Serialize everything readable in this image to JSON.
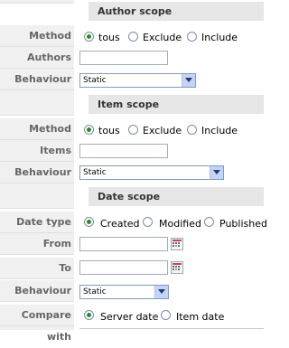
{
  "author_scope": {
    "title": "Author scope",
    "method_label": "Method",
    "method_options": [
      "tous",
      "Exclude",
      "Include"
    ],
    "authors_label": "Authors",
    "authors_value": "",
    "behaviour_label": "Behaviour",
    "behaviour_value": "Static"
  },
  "item_scope": {
    "title": "Item scope",
    "method_label": "Method",
    "method_options": [
      "tous",
      "Exclude",
      "Include"
    ],
    "items_label": "Items",
    "items_value": "",
    "behaviour_label": "Behaviour",
    "behaviour_value": "Static"
  },
  "date_scope": {
    "title": "Date scope",
    "date_type_label": "Date type",
    "date_type_options": [
      "Created",
      "Modified",
      "Published"
    ],
    "from_label": "From",
    "from_value": "",
    "to_label": "To",
    "to_value": "",
    "behaviour_label": "Behaviour",
    "behaviour_value": "Static",
    "compare_label": "Compare with",
    "compare_options": [
      "Server date",
      "Item date"
    ]
  },
  "colors": {
    "label_bg": "#f0f0f0",
    "section_bg": "#e6e6e6",
    "radio_dot": "#2a8a2a"
  }
}
